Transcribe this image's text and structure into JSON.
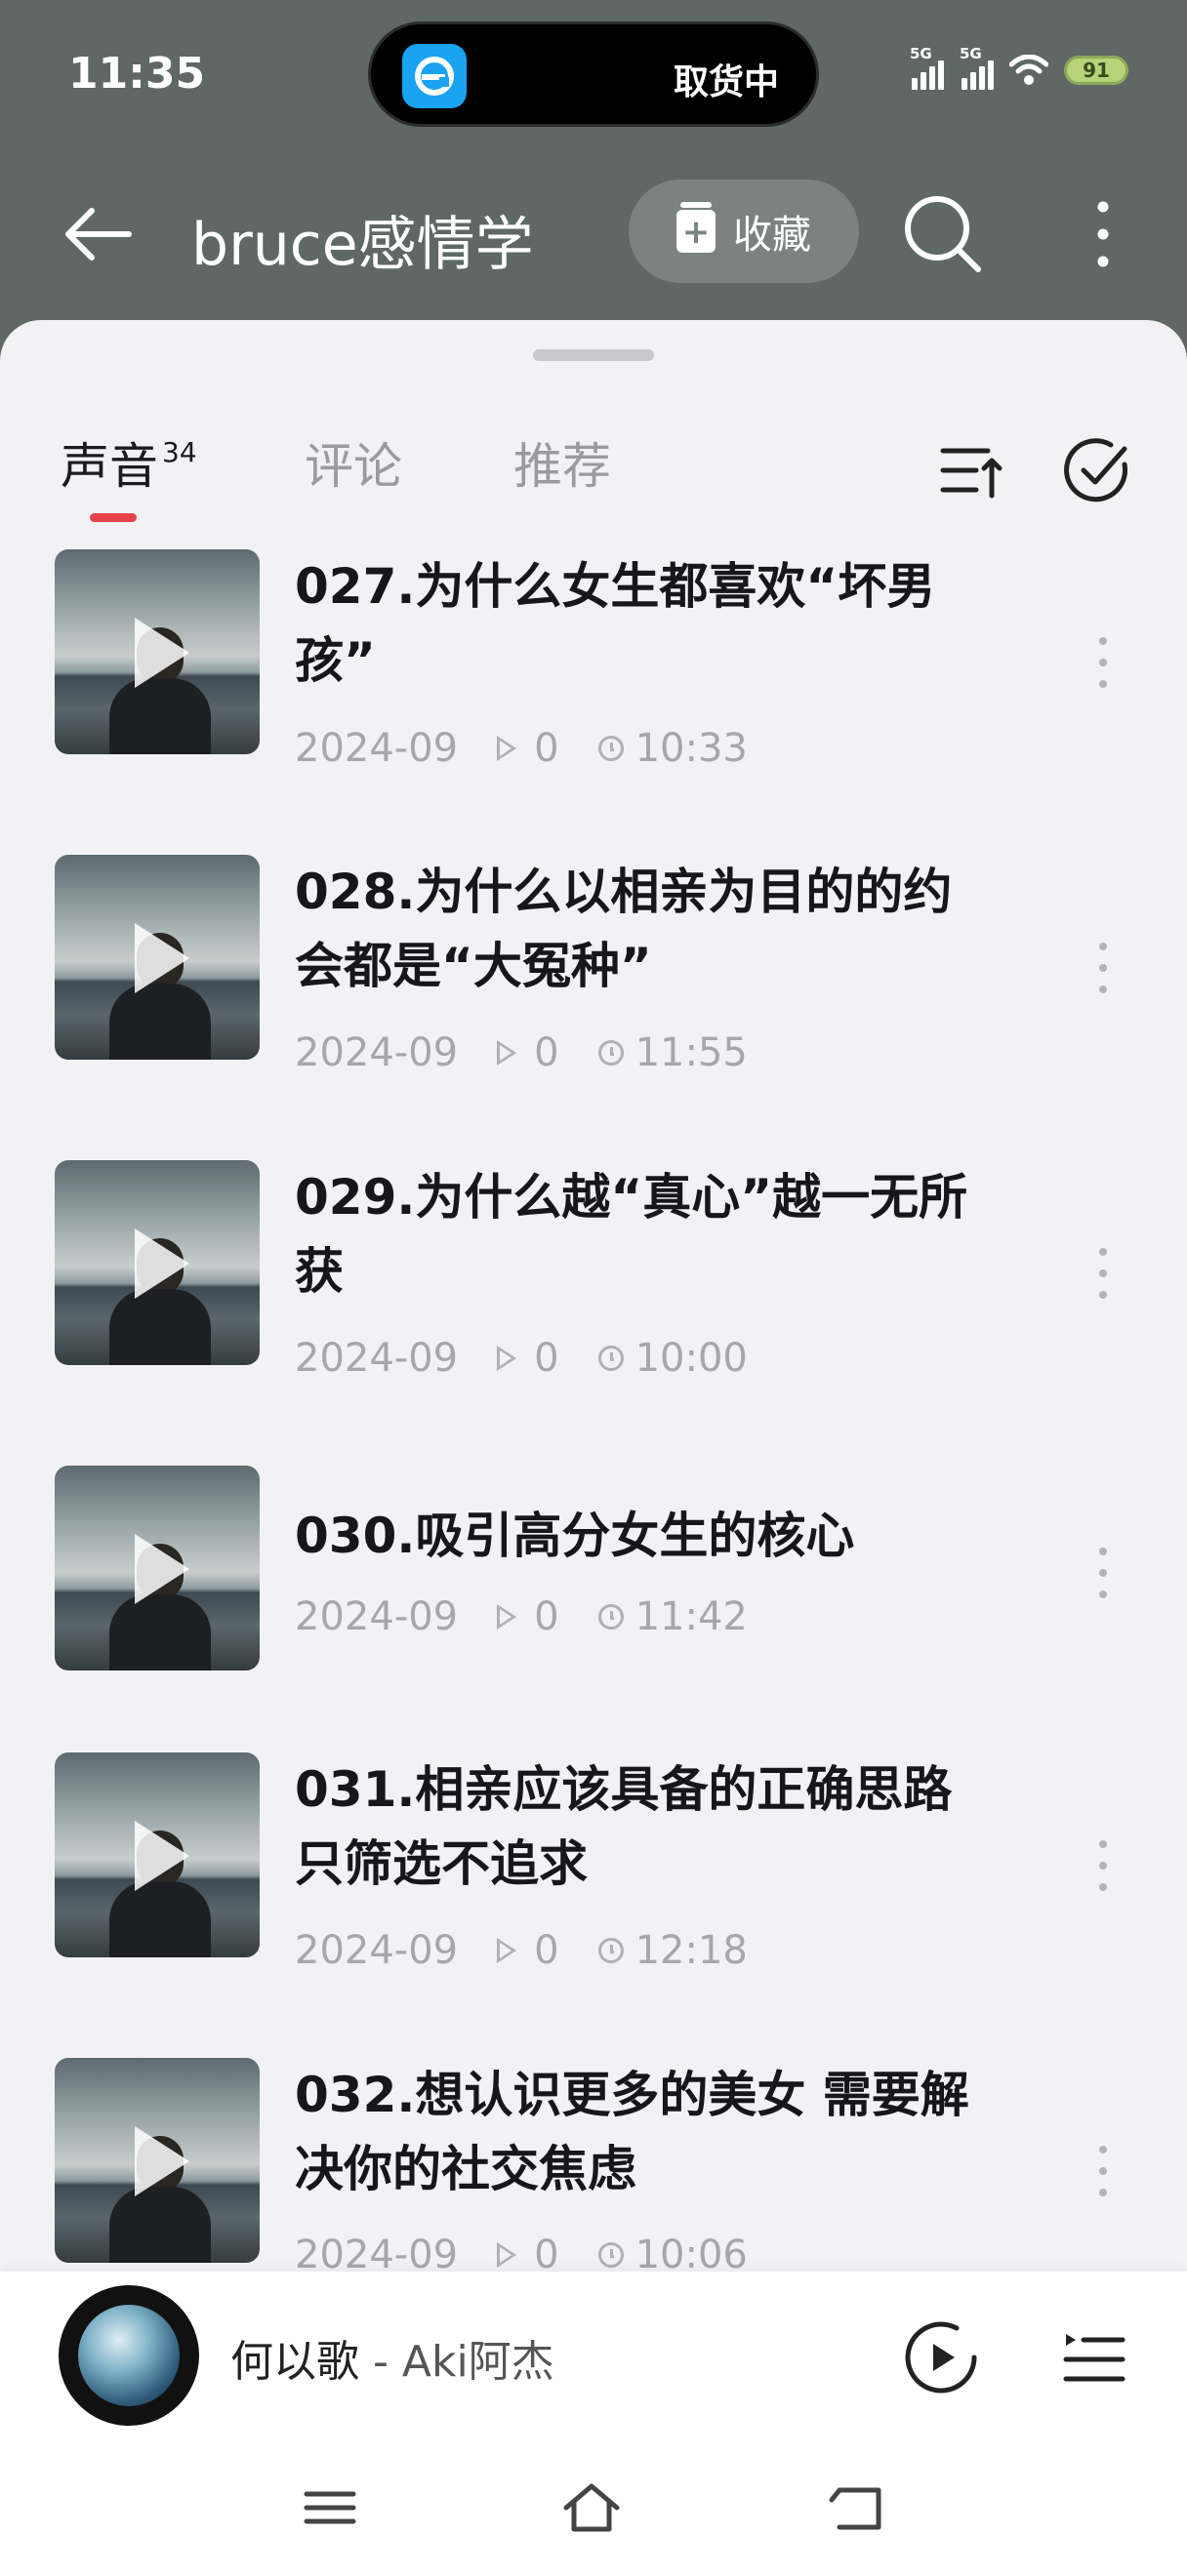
{
  "status_bar": {
    "time": "11:35",
    "island_text": "取货中",
    "signal1_label": "5G",
    "signal2_label": "5G",
    "battery": "91"
  },
  "header": {
    "title": "bruce感情学",
    "collect_label": "收藏"
  },
  "tabs": [
    {
      "label": "声音",
      "count": "34"
    },
    {
      "label": "评论"
    },
    {
      "label": "推荐"
    }
  ],
  "tracks": [
    {
      "title": "027.为什么女生都喜欢“坏男孩”",
      "date": "2024-09",
      "plays": "0",
      "duration": "10:33"
    },
    {
      "title": "028.为什么以相亲为目的的约会都是“大冤种”",
      "date": "2024-09",
      "plays": "0",
      "duration": "11:55"
    },
    {
      "title": "029.为什么越“真心”越一无所获",
      "date": "2024-09",
      "plays": "0",
      "duration": "10:00"
    },
    {
      "title": "030.吸引高分女生的核心",
      "date": "2024-09",
      "plays": "0",
      "duration": "11:42"
    },
    {
      "title": "031.相亲应该具备的正确思路 只筛选不追求",
      "date": "2024-09",
      "plays": "0",
      "duration": "12:18"
    },
    {
      "title": "032.想认识更多的美女 需要解决你的社交焦虑",
      "date": "2024-09",
      "plays": "0",
      "duration": "10:06"
    }
  ],
  "now_playing": {
    "song": "何以歌",
    "separator": " - ",
    "artist": "Aki阿杰"
  },
  "colors": {
    "header_bg": "#5f6865",
    "sheet_bg": "#f2f2f4",
    "tab_indicator": "#e8414a"
  }
}
